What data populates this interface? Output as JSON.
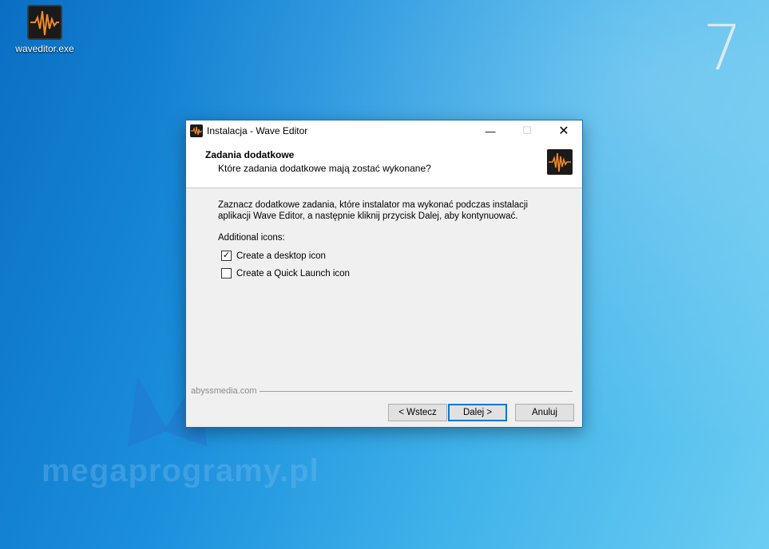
{
  "desktop": {
    "icon_label": "waveditor.exe",
    "step_number": "7",
    "watermark": "megaprogramy.pl"
  },
  "dialog": {
    "title": "Instalacja - Wave Editor",
    "header_title": "Zadania dodatkowe",
    "header_subtitle": "Które zadania dodatkowe mają zostać wykonane?",
    "description": "Zaznacz dodatkowe zadania, które instalator ma wykonać podczas instalacji aplikacji Wave Editor, a następnie kliknij przycisk Dalej, aby kontynuować.",
    "group_label": "Additional icons:",
    "checkboxes": [
      {
        "label": "Create a desktop icon",
        "checked": true
      },
      {
        "label": "Create a Quick Launch icon",
        "checked": false
      }
    ],
    "footer_brand": "abyssmedia.com",
    "buttons": {
      "back": "< Wstecz",
      "next": "Dalej >",
      "cancel": "Anuluj"
    },
    "window_controls": {
      "minimize": "—",
      "maximize": "☐",
      "close": "✕"
    }
  },
  "colors": {
    "accent": "#0078d7",
    "waveform": "#f08a24"
  }
}
